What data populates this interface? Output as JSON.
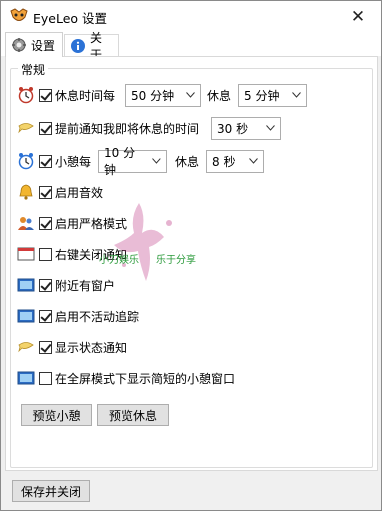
{
  "window": {
    "title": "EyeLeo 设置",
    "close_glyph": "✕"
  },
  "tabs": [
    {
      "label": "设置",
      "icon": "gear-icon",
      "active": true
    },
    {
      "label": "关于",
      "icon": "info-icon",
      "active": false
    }
  ],
  "group": {
    "title": "常规"
  },
  "rows": {
    "break": {
      "label": "休息时间每",
      "interval": "50 分钟",
      "rest_label": "休息",
      "rest": "5 分钟",
      "checked": true
    },
    "notify": {
      "label": "提前通知我即将休息的时间",
      "value": "30 秒",
      "checked": true
    },
    "mini": {
      "label": "小憩每",
      "interval": "10 分钟",
      "rest_label": "休息",
      "rest": "8 秒",
      "checked": true
    },
    "sound": {
      "label": "启用音效",
      "checked": true
    },
    "strict": {
      "label": "启用严格模式",
      "checked": true
    },
    "rightclick": {
      "label": "右键关闭通知",
      "checked": false
    },
    "near": {
      "label": "附近有窗户",
      "checked": true
    },
    "inactive": {
      "label": "启用不活动追踪",
      "checked": true
    },
    "status": {
      "label": "显示状态通知",
      "checked": true
    },
    "fullscreen": {
      "label": "在全屏模式下显示简短的小憩窗口",
      "checked": false
    }
  },
  "buttons": {
    "preview_mini": "预览小憩",
    "preview_break": "预览休息",
    "save_close": "保存并关闭"
  },
  "watermark": {
    "text_line1": "小刀娱乐",
    "text_line2": "乐于分享"
  },
  "colors": {
    "accent": "#0078d7",
    "watermark": "#2a9a3a",
    "splash": "#c0408a"
  }
}
